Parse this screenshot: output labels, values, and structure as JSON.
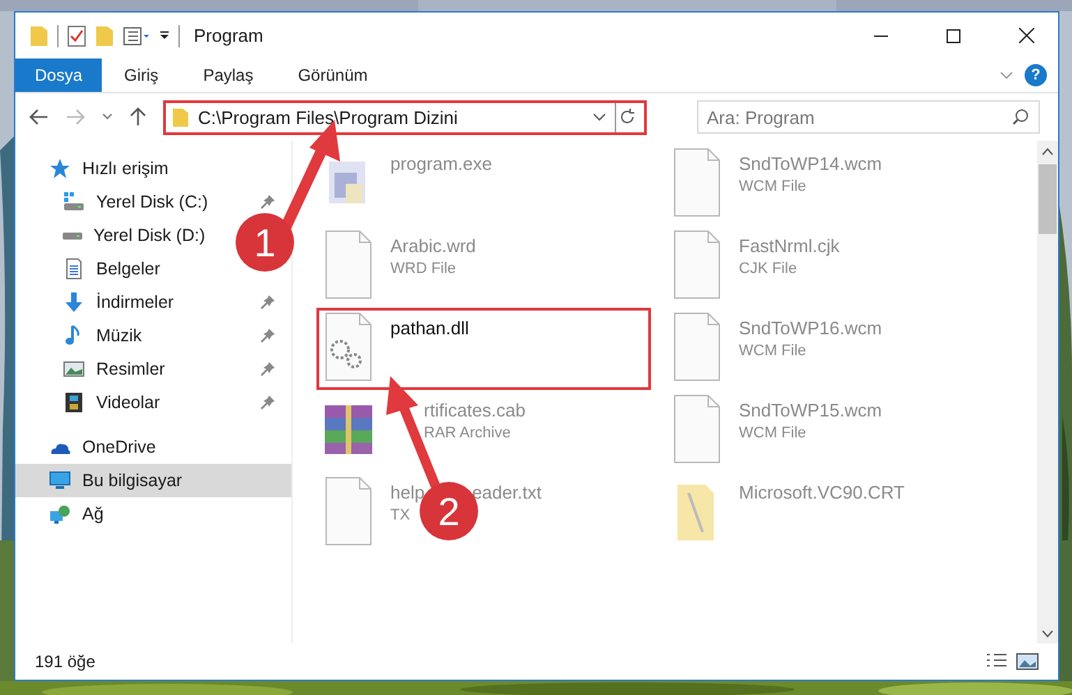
{
  "window": {
    "title": "Program"
  },
  "ribbon": {
    "tabs": [
      {
        "label": "Dosya",
        "selected": true
      },
      {
        "label": "Giriş",
        "selected": false
      },
      {
        "label": "Paylaş",
        "selected": false
      },
      {
        "label": "Görünüm",
        "selected": false
      }
    ],
    "help": "?"
  },
  "address": {
    "path": "C:\\Program Files\\Program Dizini",
    "highlighted": true
  },
  "search": {
    "placeholder": "Ara: Program"
  },
  "sidebar": {
    "items": [
      {
        "label": "Hızlı erişim",
        "kind": "quick-access",
        "pinned": false,
        "selected": false,
        "children": [
          {
            "label": "Yerel Disk (C:)",
            "kind": "drive-c",
            "pinned": true,
            "selected": false
          },
          {
            "label": "Yerel Disk (D:)",
            "kind": "drive",
            "selected": false
          },
          {
            "label": "Belgeler",
            "kind": "documents",
            "selected": false
          },
          {
            "label": "İndirmeler",
            "kind": "downloads",
            "pinned": true,
            "selected": false
          },
          {
            "label": "Müzik",
            "kind": "music",
            "pinned": true,
            "selected": false
          },
          {
            "label": "Resimler",
            "kind": "pictures",
            "pinned": true,
            "selected": false
          },
          {
            "label": "Videolar",
            "kind": "videos",
            "pinned": true,
            "selected": false
          }
        ]
      },
      {
        "label": "OneDrive",
        "kind": "cloud",
        "pinned": false,
        "selected": false
      },
      {
        "label": "Bu bilgisayar",
        "kind": "computer",
        "pinned": false,
        "selected": true
      },
      {
        "label": "Ağ",
        "kind": "network",
        "pinned": false,
        "selected": false
      }
    ]
  },
  "files": [
    {
      "name": "program.exe",
      "kind": "exe",
      "highlighted": false
    },
    {
      "name": "SndToWP14.wcm",
      "type": "WCM File",
      "kind": "file",
      "highlighted": false
    },
    {
      "name": "Arabic.wrd",
      "type": "WRD File",
      "kind": "file",
      "highlighted": false
    },
    {
      "name": "FastNrml.cjk",
      "type": "CJK File",
      "kind": "file",
      "highlighted": false
    },
    {
      "name": "pathan.dll",
      "kind": "dll",
      "highlighted": true
    },
    {
      "name": "SndToWP16.wcm",
      "type": "WCM File",
      "kind": "file",
      "highlighted": false
    },
    {
      "name": "rtificates.cab",
      "type": "RAR Archive",
      "kind": "archive",
      "highlighted": false
    },
    {
      "name": "SndToWP15.wcm",
      "type": "WCM File",
      "kind": "file",
      "highlighted": false
    },
    {
      "name": "help",
      "name_after": "eader.txt",
      "type": "TX",
      "kind": "file",
      "highlighted": false
    },
    {
      "name": "Microsoft.VC90.CRT",
      "kind": "folder",
      "highlighted": false
    }
  ],
  "status_bar": {
    "count": "191 öğe"
  },
  "annotations": [
    {
      "label": "1"
    },
    {
      "label": "2"
    }
  ]
}
